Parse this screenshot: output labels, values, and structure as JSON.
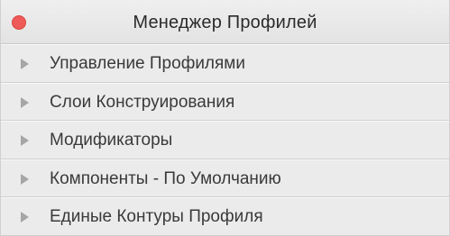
{
  "window": {
    "title": "Менеджер Профилей",
    "close_color": "#ee5a58"
  },
  "sections": [
    {
      "label": "Управление Профилями",
      "icon": "disclosure-triangle-icon",
      "expanded": false
    },
    {
      "label": "Слои Конструирования",
      "icon": "disclosure-triangle-icon",
      "expanded": false
    },
    {
      "label": "Модификаторы",
      "icon": "disclosure-triangle-icon",
      "expanded": false
    },
    {
      "label": "Компоненты - По Умолчанию",
      "icon": "disclosure-triangle-icon",
      "expanded": false
    },
    {
      "label": "Единые Контуры Профиля",
      "icon": "disclosure-triangle-icon",
      "expanded": false
    }
  ]
}
